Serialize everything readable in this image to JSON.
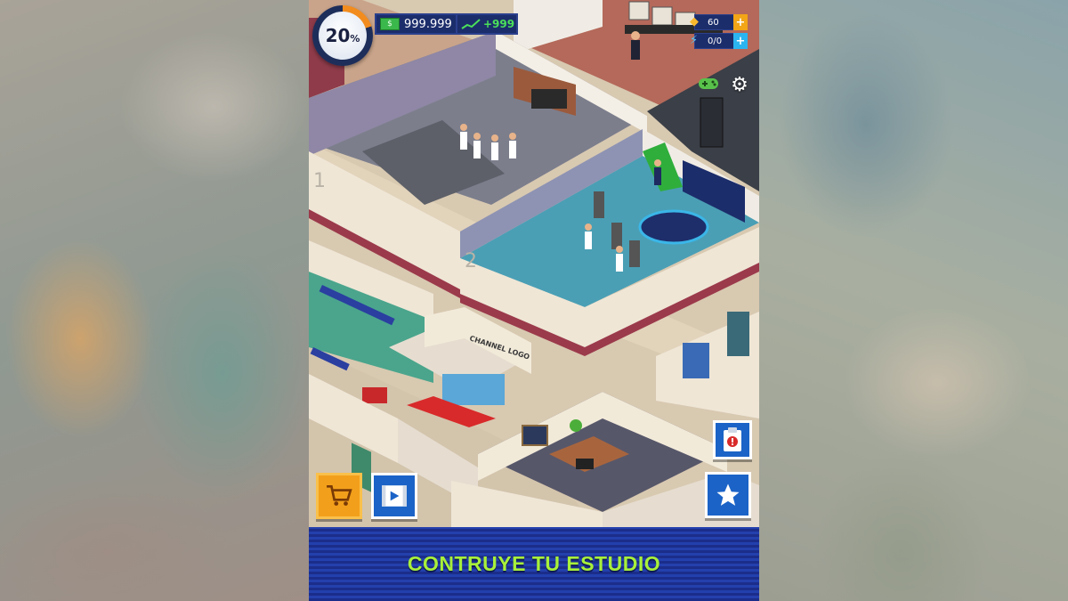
{
  "hud": {
    "progress_value": "20",
    "progress_unit": "%",
    "money": "999.999",
    "income": "+999",
    "gems": "60",
    "energy": "0/0",
    "plus": "+"
  },
  "floor_numbers": [
    "2",
    "1"
  ],
  "signs": {
    "reception_sign": "CHANNEL LOGO"
  },
  "banner": {
    "text": "CONTRUYE TU ESTUDIO"
  },
  "colors": {
    "progress_fill": "#f28c1e",
    "hud_panel": "#1c2d6b",
    "button_blue": "#1b63c7",
    "shop_orange": "#f2a01b",
    "banner_text": "#a8f03a",
    "banner_bg": "#1b2d8a"
  },
  "icons": [
    "cash-icon",
    "trend-icon",
    "gem-icon",
    "bolt-icon",
    "gamepad-icon",
    "gear-icon",
    "clipboard-alert-icon",
    "star-icon",
    "cart-icon",
    "video-icon"
  ]
}
